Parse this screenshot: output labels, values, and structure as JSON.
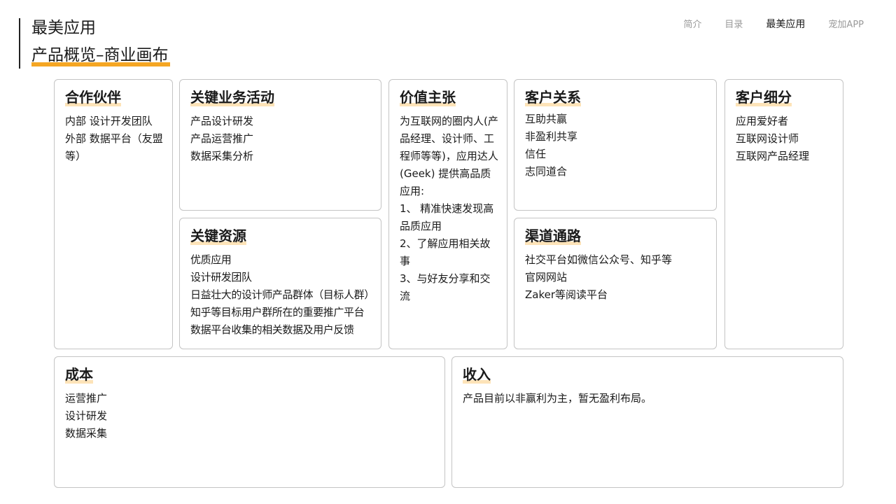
{
  "header": {
    "app_title": "最美应用",
    "page_title": "产品概览–商业画布"
  },
  "nav": {
    "items": [
      {
        "label": "简介"
      },
      {
        "label": "目录"
      },
      {
        "label": "最美应用"
      },
      {
        "label": "宠加APP"
      }
    ],
    "active_index": 2
  },
  "canvas": {
    "partners": {
      "title": "合作伙伴",
      "lines": [
        "内部 设计开发团队",
        "外部 数据平台（友盟等）"
      ]
    },
    "activities": {
      "title": "关键业务活动",
      "lines": [
        "产品设计研发",
        "产品运营推广",
        "数据采集分析"
      ]
    },
    "resources": {
      "title": "关键资源",
      "lines": [
        "优质应用",
        "设计研发团队",
        "日益壮大的设计师产品群体（目标人群）",
        "知乎等目标用户群所在的重要推广平台",
        "数据平台收集的相关数据及用户反馈"
      ]
    },
    "value": {
      "title": "价值主张",
      "lines": [
        "为互联网的圈内人(产品经理、设计师、工程师等等)，应用达人 (Geek) 提供高品质应用:",
        "1、 精准快速发现高品质应用",
        "2、了解应用相关故事",
        "3、与好友分享和交流"
      ]
    },
    "relations": {
      "title": "客户关系",
      "lines": [
        "互助共赢",
        "非盈利共享",
        "信任",
        "志同道合"
      ]
    },
    "channels": {
      "title": "渠道通路",
      "lines": [
        "社交平台如微信公众号、知乎等",
        "官网网站",
        "Zaker等阅读平台"
      ]
    },
    "segments": {
      "title": "客户细分",
      "lines": [
        "应用爱好者",
        "互联网设计师",
        "互联网产品经理"
      ]
    },
    "cost": {
      "title": "成本",
      "lines": [
        "运营推广",
        "设计研发",
        "数据采集"
      ]
    },
    "revenue": {
      "title": "收入",
      "lines": [
        "产品目前以非赢利为主，暂无盈利布局。"
      ]
    }
  },
  "colors": {
    "accent": "#f5a623",
    "title_highlight": "#fde3b8",
    "card_border": "#c4c4c4"
  }
}
